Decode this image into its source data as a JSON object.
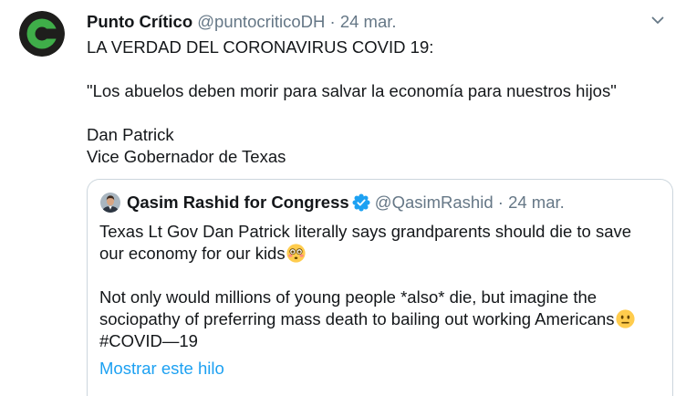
{
  "tweet": {
    "author": {
      "name": "Punto Crítico",
      "handle": "@puntocriticoDH",
      "avatar_icon": "punto-critico-logo-icon"
    },
    "separator": "·",
    "date": "24 mar.",
    "menu_icon": "chevron-down-icon",
    "text_lines": [
      "LA VERDAD DEL CORONAVIRUS COVID 19:",
      "\"Los abuelos deben morir para salvar la economía para nuestros hijos\"",
      "Dan Patrick",
      "Vice Gobernador de Texas"
    ]
  },
  "quoted": {
    "author": {
      "name": "Qasim Rashid for Congress",
      "handle": "@QasimRashid",
      "verified": true,
      "verified_icon": "verified-badge-icon"
    },
    "separator": "·",
    "date": "24 mar.",
    "lines": [
      {
        "text": "Texas Lt Gov Dan Patrick literally says grandparents should die to save"
      },
      {
        "text": "our economy for our kids",
        "emoji": "flushed-face-icon"
      },
      {
        "text": "Not only would millions of young people *also* die, but imagine the"
      },
      {
        "text": "sociopathy of preferring mass death to bailing out working Americans",
        "emoji": "neutral-face-icon"
      },
      {
        "text": "#COVID—19"
      }
    ],
    "thread_link": "Mostrar este hilo"
  },
  "colors": {
    "text": "#14171a",
    "secondary": "#657786",
    "link": "#1da1f2",
    "border": "#ccd6dd",
    "logo-green": "#3fae49",
    "logo-dark": "#1e1e1c"
  }
}
